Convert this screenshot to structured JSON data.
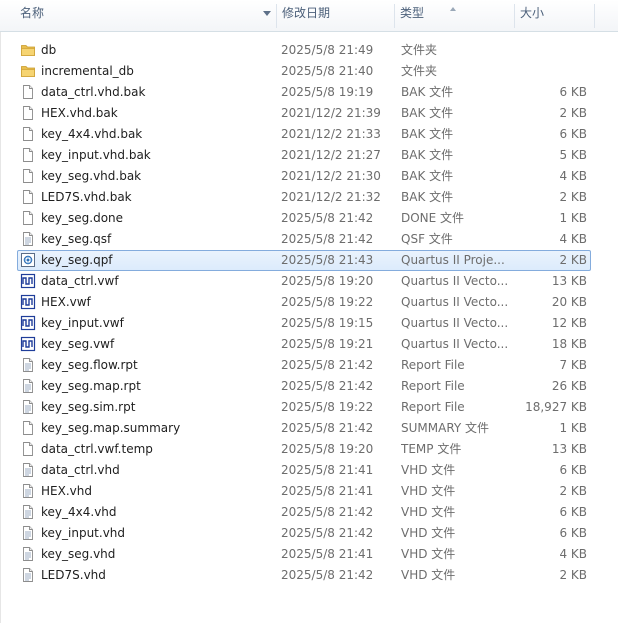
{
  "columns": {
    "name": "名称",
    "date": "修改日期",
    "type": "类型",
    "size": "大小"
  },
  "files": [
    {
      "name": "db",
      "date": "2025/5/8 21:49",
      "type": "文件夹",
      "size": "",
      "icon": "folder-icon"
    },
    {
      "name": "incremental_db",
      "date": "2025/5/8 21:40",
      "type": "文件夹",
      "size": "",
      "icon": "folder-icon"
    },
    {
      "name": "data_ctrl.vhd.bak",
      "date": "2025/5/8 19:19",
      "type": "BAK 文件",
      "size": "6 KB",
      "icon": "file-icon"
    },
    {
      "name": "HEX.vhd.bak",
      "date": "2021/12/2 21:39",
      "type": "BAK 文件",
      "size": "2 KB",
      "icon": "file-icon"
    },
    {
      "name": "key_4x4.vhd.bak",
      "date": "2021/12/2 21:33",
      "type": "BAK 文件",
      "size": "6 KB",
      "icon": "file-icon"
    },
    {
      "name": "key_input.vhd.bak",
      "date": "2021/12/2 21:27",
      "type": "BAK 文件",
      "size": "5 KB",
      "icon": "file-icon"
    },
    {
      "name": "key_seg.vhd.bak",
      "date": "2021/12/2 21:30",
      "type": "BAK 文件",
      "size": "4 KB",
      "icon": "file-icon"
    },
    {
      "name": "LED7S.vhd.bak",
      "date": "2021/12/2 21:32",
      "type": "BAK 文件",
      "size": "2 KB",
      "icon": "file-icon"
    },
    {
      "name": "key_seg.done",
      "date": "2025/5/8 21:42",
      "type": "DONE 文件",
      "size": "1 KB",
      "icon": "file-icon"
    },
    {
      "name": "key_seg.qsf",
      "date": "2025/5/8 21:42",
      "type": "QSF 文件",
      "size": "4 KB",
      "icon": "text-file-icon"
    },
    {
      "name": "key_seg.qpf",
      "date": "2025/5/8 21:43",
      "type": "Quartus II Proje...",
      "size": "2 KB",
      "icon": "quartus-project-icon",
      "selected": true
    },
    {
      "name": "data_ctrl.vwf",
      "date": "2025/5/8 19:20",
      "type": "Quartus II Vecto...",
      "size": "13 KB",
      "icon": "waveform-icon"
    },
    {
      "name": "HEX.vwf",
      "date": "2025/5/8 19:22",
      "type": "Quartus II Vecto...",
      "size": "20 KB",
      "icon": "waveform-icon"
    },
    {
      "name": "key_input.vwf",
      "date": "2025/5/8 19:15",
      "type": "Quartus II Vecto...",
      "size": "12 KB",
      "icon": "waveform-icon"
    },
    {
      "name": "key_seg.vwf",
      "date": "2025/5/8 19:21",
      "type": "Quartus II Vecto...",
      "size": "18 KB",
      "icon": "waveform-icon"
    },
    {
      "name": "key_seg.flow.rpt",
      "date": "2025/5/8 21:42",
      "type": "Report File",
      "size": "7 KB",
      "icon": "text-file-icon"
    },
    {
      "name": "key_seg.map.rpt",
      "date": "2025/5/8 21:42",
      "type": "Report File",
      "size": "26 KB",
      "icon": "text-file-icon"
    },
    {
      "name": "key_seg.sim.rpt",
      "date": "2025/5/8 19:22",
      "type": "Report File",
      "size": "18,927 KB",
      "icon": "text-file-icon"
    },
    {
      "name": "key_seg.map.summary",
      "date": "2025/5/8 21:42",
      "type": "SUMMARY 文件",
      "size": "1 KB",
      "icon": "file-icon"
    },
    {
      "name": "data_ctrl.vwf.temp",
      "date": "2025/5/8 19:20",
      "type": "TEMP 文件",
      "size": "13 KB",
      "icon": "file-icon"
    },
    {
      "name": "data_ctrl.vhd",
      "date": "2025/5/8 21:41",
      "type": "VHD 文件",
      "size": "6 KB",
      "icon": "text-file-icon"
    },
    {
      "name": "HEX.vhd",
      "date": "2025/5/8 21:41",
      "type": "VHD 文件",
      "size": "2 KB",
      "icon": "text-file-icon"
    },
    {
      "name": "key_4x4.vhd",
      "date": "2025/5/8 21:42",
      "type": "VHD 文件",
      "size": "6 KB",
      "icon": "text-file-icon"
    },
    {
      "name": "key_input.vhd",
      "date": "2025/5/8 21:42",
      "type": "VHD 文件",
      "size": "6 KB",
      "icon": "text-file-icon"
    },
    {
      "name": "key_seg.vhd",
      "date": "2025/5/8 21:41",
      "type": "VHD 文件",
      "size": "4 KB",
      "icon": "text-file-icon"
    },
    {
      "name": "LED7S.vhd",
      "date": "2025/5/8 21:42",
      "type": "VHD 文件",
      "size": "2 KB",
      "icon": "text-file-icon"
    }
  ]
}
